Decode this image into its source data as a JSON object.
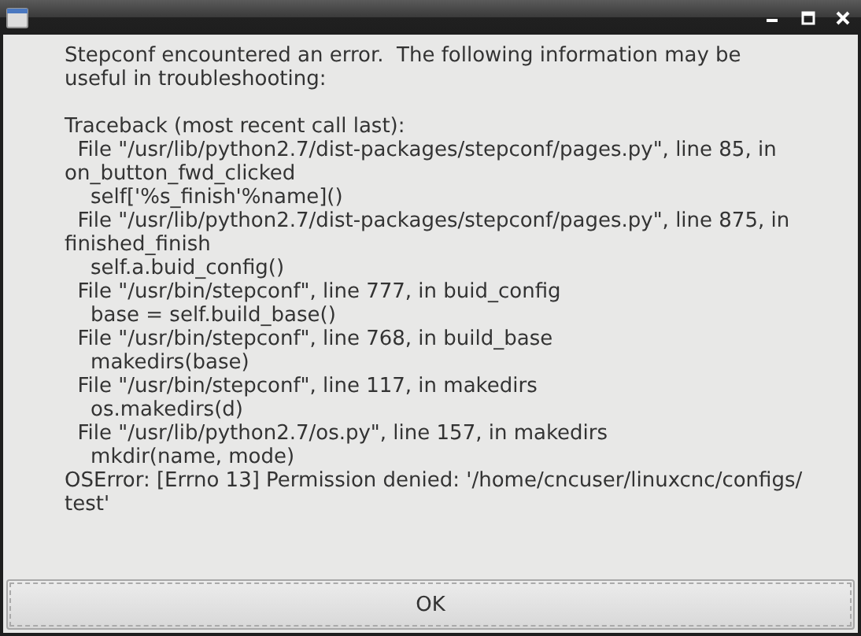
{
  "message": {
    "summary_lines": [
      "Stepconf encountered an error.  The following information may be",
      "useful in troubleshooting:"
    ],
    "traceback_lines": [
      "Traceback (most recent call last):",
      "  File \"/usr/lib/python2.7/dist-packages/stepconf/pages.py\", line 85, in",
      "on_button_fwd_clicked",
      "    self['%s_finish'%name]()",
      "  File \"/usr/lib/python2.7/dist-packages/stepconf/pages.py\", line 875, in",
      "finished_finish",
      "    self.a.buid_config()",
      "  File \"/usr/bin/stepconf\", line 777, in buid_config",
      "    base = self.build_base()",
      "  File \"/usr/bin/stepconf\", line 768, in build_base",
      "    makedirs(base)",
      "  File \"/usr/bin/stepconf\", line 117, in makedirs",
      "    os.makedirs(d)",
      "  File \"/usr/lib/python2.7/os.py\", line 157, in makedirs",
      "    mkdir(name, mode)",
      "OSError: [Errno 13] Permission denied: '/home/cncuser/linuxcnc/configs/",
      "test'"
    ]
  },
  "buttons": [
    "OK"
  ]
}
